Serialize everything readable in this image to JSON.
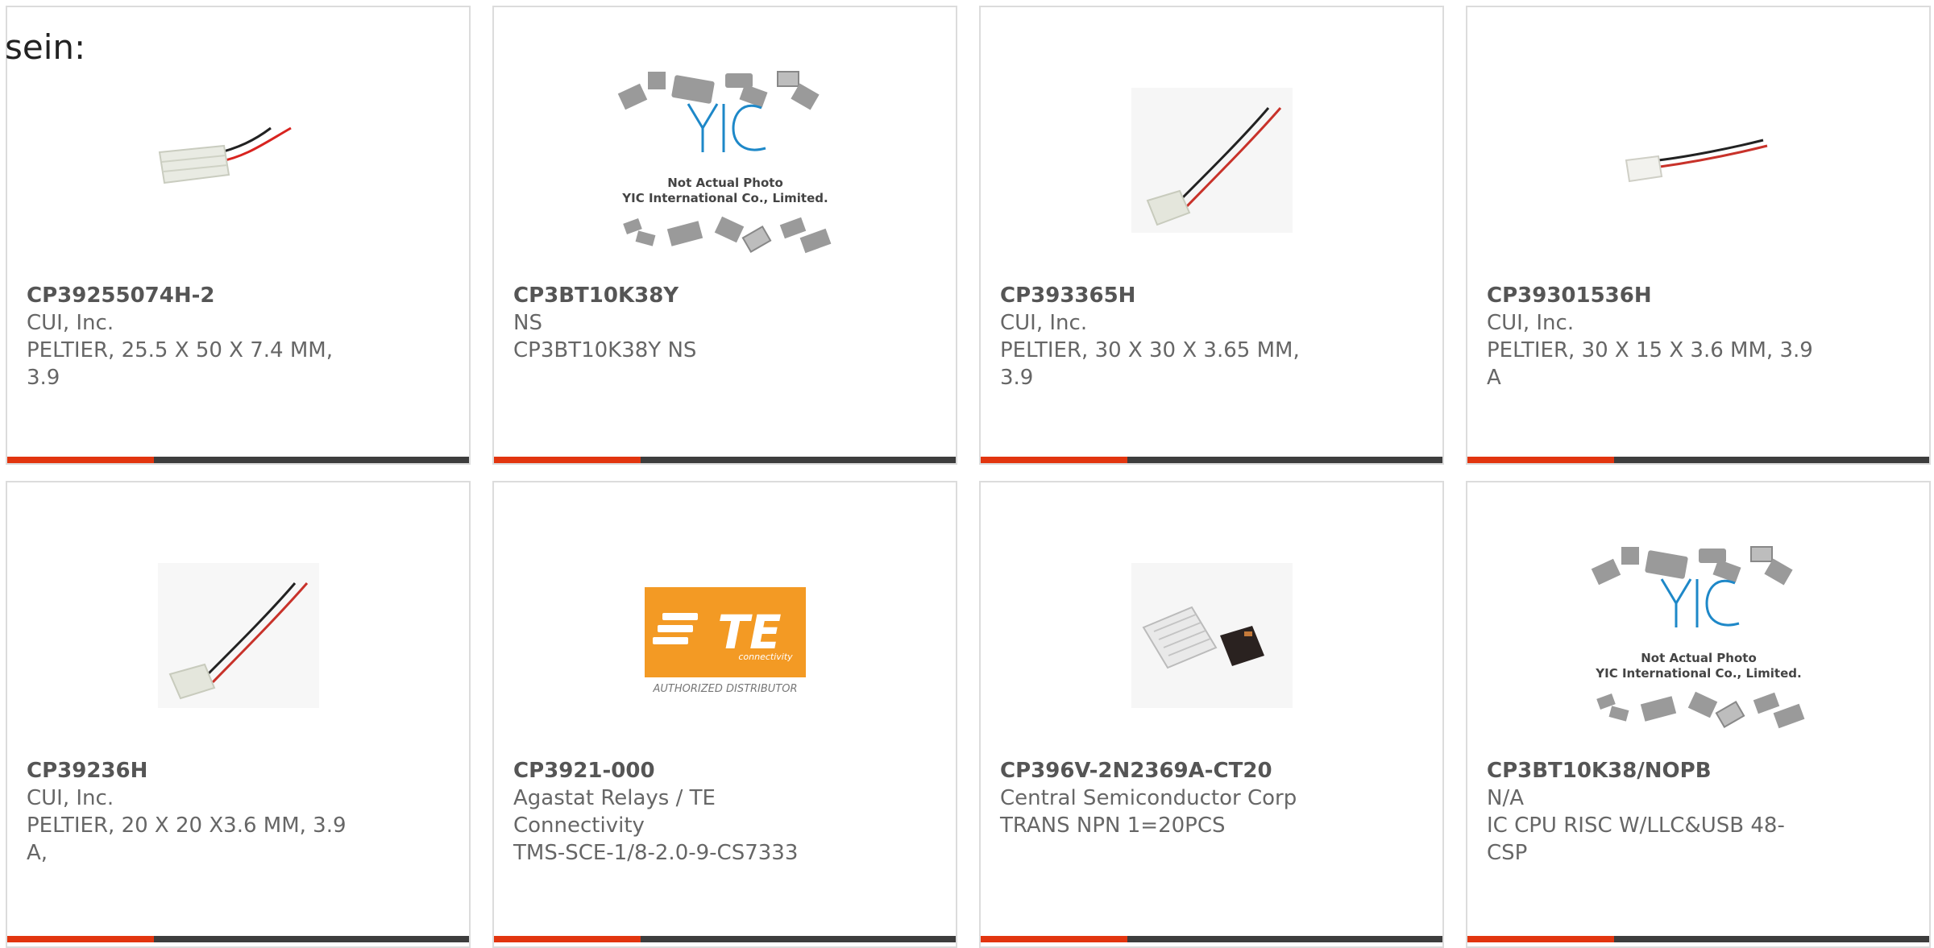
{
  "header": {
    "partial_text": "sein:"
  },
  "products": [
    {
      "part_number": "CP39255074H-2",
      "manufacturer": "CUI, Inc.",
      "description": "PELTIER, 25.5 X 50 X 7.4 MM, 3.9",
      "image": "peltier-module-image"
    },
    {
      "part_number": "CP3BT10K38Y",
      "manufacturer": "NS",
      "description": "CP3BT10K38Y NS",
      "image": "yic-placeholder-image",
      "placeholder_line1": "Not Actual Photo",
      "placeholder_line2": "YIC International Co., Limited."
    },
    {
      "part_number": "CP393365H",
      "manufacturer": "CUI, Inc.",
      "description": "PELTIER, 30 X 30 X 3.65 MM, 3.9",
      "image": "peltier-module-image"
    },
    {
      "part_number": "CP39301536H",
      "manufacturer": "CUI, Inc.",
      "description": "PELTIER, 30 X 15 X 3.6 MM, 3.9 A",
      "image": "peltier-module-image"
    },
    {
      "part_number": "CP39236H",
      "manufacturer": "CUI, Inc.",
      "description": "PELTIER, 20 X 20 X3.6 MM, 3.9 A,",
      "image": "peltier-module-image"
    },
    {
      "part_number": "CP3921-000",
      "manufacturer": "Agastat Relays / TE Connectivity",
      "description": "TMS-SCE-1/8-2.0-9-CS7333",
      "image": "te-connectivity-logo",
      "logo_text": "TE",
      "logo_subtext": "connectivity",
      "logo_caption": "AUTHORIZED DISTRIBUTOR"
    },
    {
      "part_number": "CP396V-2N2369A-CT20",
      "manufacturer": "Central Semiconductor Corp",
      "description": "TRANS NPN 1=20PCS",
      "image": "semiconductor-chip-image"
    },
    {
      "part_number": "CP3BT10K38/NOPB",
      "manufacturer": "N/A",
      "description": "IC CPU RISC W/LLC&USB 48-CSP",
      "image": "yic-placeholder-image",
      "placeholder_line1": "Not Actual Photo",
      "placeholder_line2": "YIC International Co., Limited."
    }
  ],
  "colors": {
    "accent": "#e2350f",
    "bar": "#3d3d3d",
    "yic_blue": "#1e88c8",
    "te_orange": "#f39a24"
  }
}
